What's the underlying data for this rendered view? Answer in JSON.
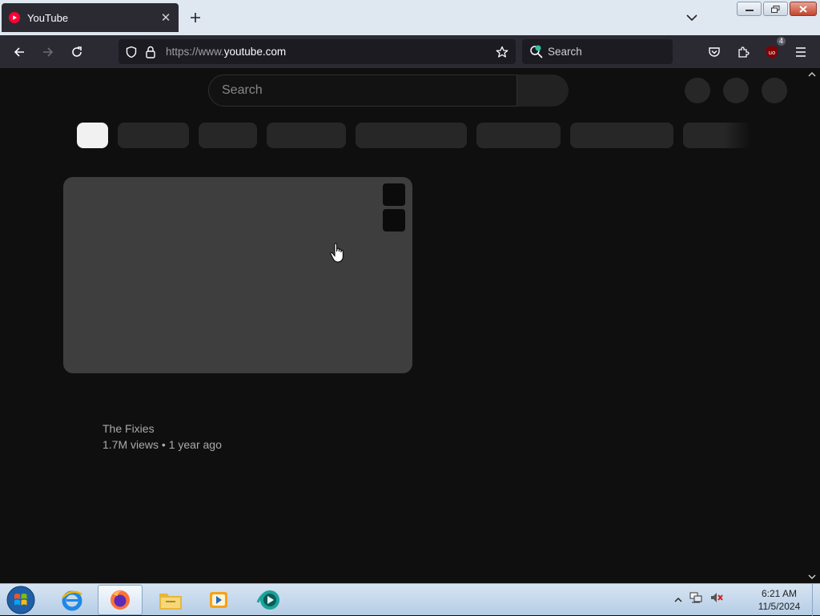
{
  "browser": {
    "tab": {
      "title": "YouTube"
    },
    "url": {
      "prefix": "https://www.",
      "domain": "youtube.com"
    },
    "search_placeholder": "Search",
    "extension_badge": "4"
  },
  "youtube": {
    "search_placeholder": "Search",
    "video": {
      "channel": "The Fixies",
      "meta": "1.7M views • 1 year ago"
    }
  },
  "taskbar": {
    "time": "6:21 AM",
    "date": "11/5/2024"
  },
  "colors": {
    "page_bg": "#0f0f0f",
    "chip_active": "#f1f1f1",
    "thumbnail_placeholder": "#3e3e3e",
    "youtube_red": "#ff0033"
  }
}
